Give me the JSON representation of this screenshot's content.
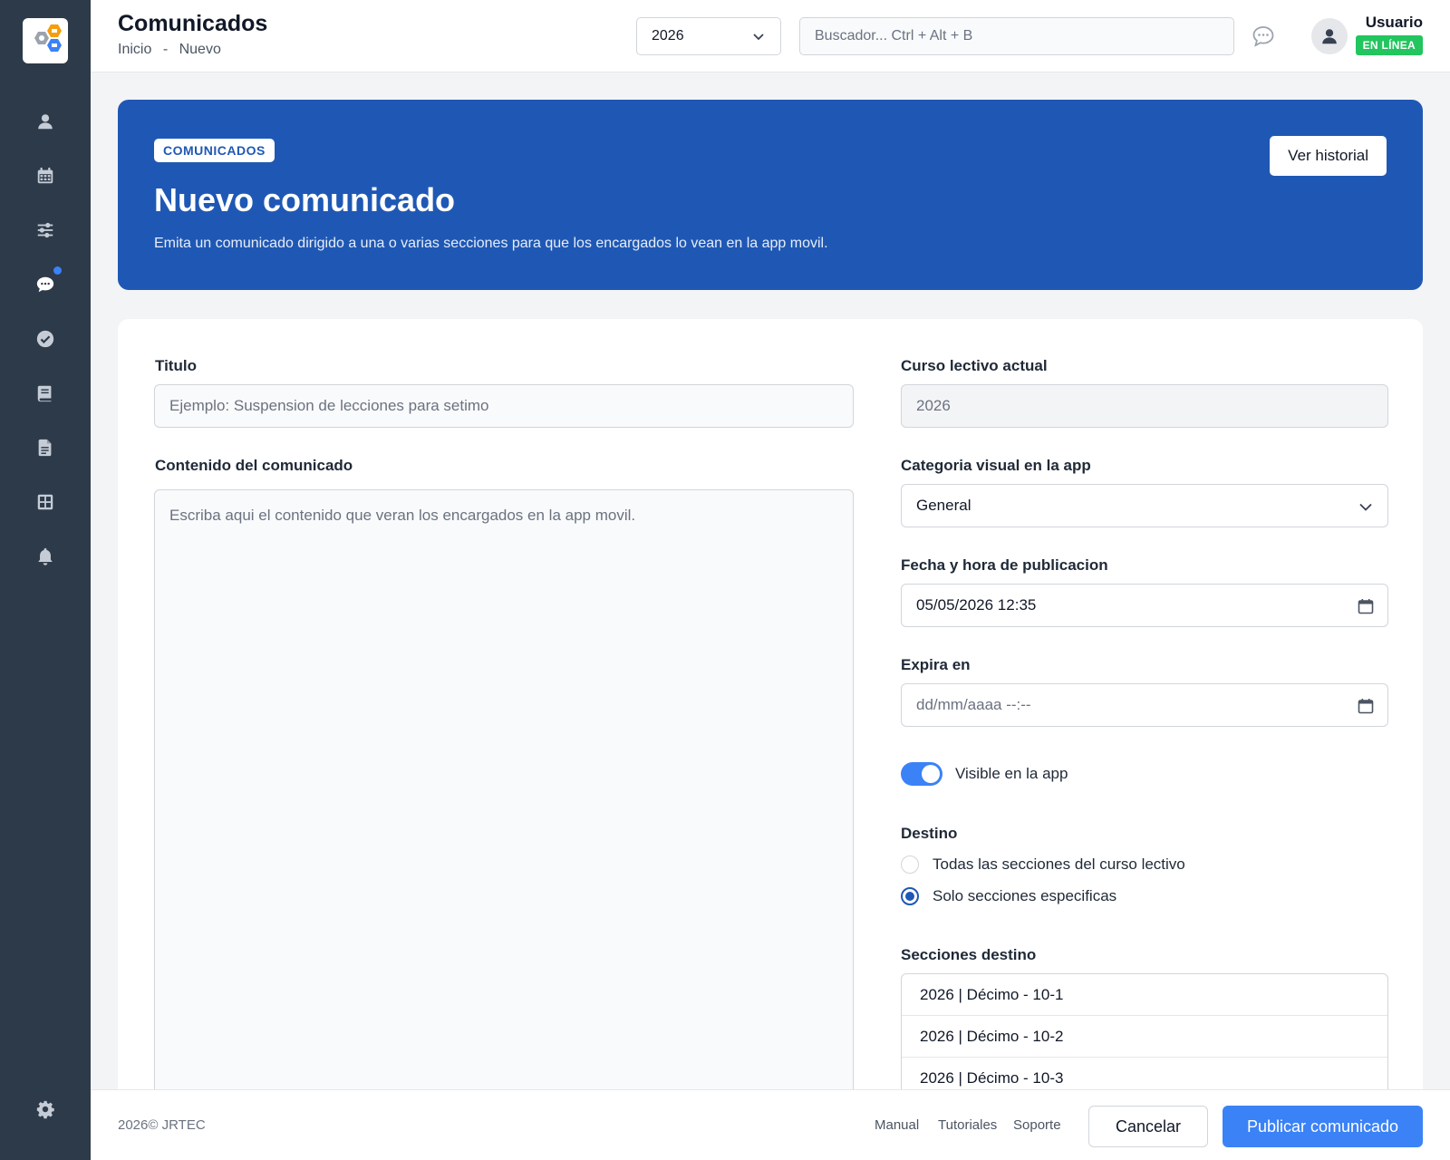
{
  "header": {
    "title": "Comunicados",
    "breadcrumb": [
      "Inicio",
      "-",
      "Nuevo"
    ],
    "year_select": "2026",
    "search_placeholder": "Buscador... Ctrl + Alt + B",
    "user_name": "Usuario",
    "status": "EN LÍNEA"
  },
  "sidebar": {
    "items": [
      {
        "icon": "user-icon"
      },
      {
        "icon": "calendar-icon"
      },
      {
        "icon": "sliders-icon"
      },
      {
        "icon": "chat-icon",
        "has_notification": true
      },
      {
        "icon": "check-circle-icon"
      },
      {
        "icon": "book-icon"
      },
      {
        "icon": "document-icon"
      },
      {
        "icon": "grid-icon"
      },
      {
        "icon": "bell-icon"
      }
    ],
    "bottom_icon": "gear-icon"
  },
  "hero": {
    "tag": "COMUNICADOS",
    "title": "Nuevo comunicado",
    "subtitle": "Emita un comunicado dirigido a una o varias secciones para que los encargados lo vean en la app movil.",
    "history_button": "Ver historial"
  },
  "form": {
    "title_label": "Titulo",
    "title_placeholder": "Ejemplo: Suspension de lecciones para setimo",
    "content_label": "Contenido del comunicado",
    "content_placeholder": "Escriba aqui el contenido que veran los encargados en la app movil.",
    "course_label": "Curso lectivo actual",
    "course_value": "2026",
    "category_label": "Categoria visual en la app",
    "category_value": "General",
    "publish_date_label": "Fecha y hora de publicacion",
    "publish_date_value": "05/05/2026 12:35",
    "expires_label": "Expira en",
    "expires_placeholder": "dd/mm/aaaa --:--",
    "visible_label": "Visible en la app",
    "visible_on": true,
    "destination_label": "Destino",
    "destination_options": [
      {
        "label": "Todas las secciones del curso lectivo",
        "checked": false
      },
      {
        "label": "Solo secciones especificas",
        "checked": true
      }
    ],
    "sections_label": "Secciones destino",
    "sections": [
      "2026 | Décimo - 10-1",
      "2026 | Décimo - 10-2",
      "2026 | Décimo - 10-3"
    ]
  },
  "footer": {
    "copyright": "2026© JRTEC",
    "links": [
      "Manual",
      "Tutoriales",
      "Soporte"
    ],
    "cancel": "Cancelar",
    "publish": "Publicar comunicado"
  },
  "colors": {
    "sidebar": "#2d3a4a",
    "hero": "#1f58b4",
    "primary": "#3b82f6",
    "status": "#22c55e"
  }
}
